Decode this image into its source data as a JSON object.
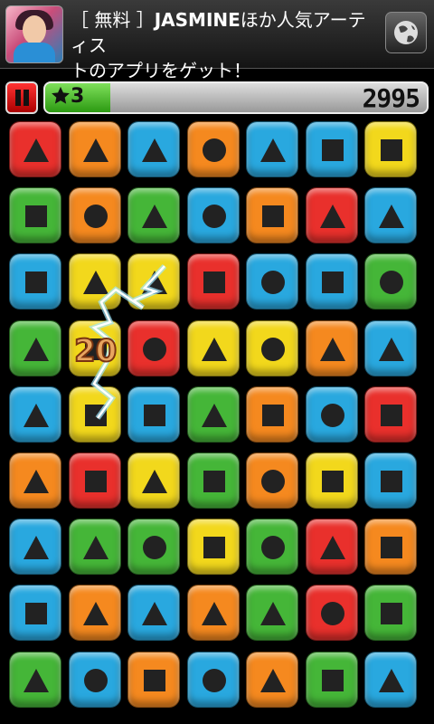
{
  "ad": {
    "line1_prefix": "［ 無料 ］",
    "line1_brand": "JASMINE",
    "line1_suffix": "ほか人気アーティス",
    "line2": "トのアプリをゲット！"
  },
  "hud": {
    "level": "3",
    "score": "2995",
    "progress_fraction": 0.17
  },
  "popup_points": "20",
  "colors": {
    "red": "#e9302c",
    "orange": "#f5891f",
    "blue": "#29a8df",
    "green": "#45b638",
    "yellow": "#f2d81c"
  },
  "board": [
    [
      [
        "red",
        "triangle"
      ],
      [
        "orange",
        "triangle"
      ],
      [
        "blue",
        "triangle"
      ],
      [
        "orange",
        "circle"
      ],
      [
        "blue",
        "triangle"
      ],
      [
        "blue",
        "square"
      ],
      [
        "yellow",
        "square"
      ]
    ],
    [
      [
        "green",
        "square"
      ],
      [
        "orange",
        "circle"
      ],
      [
        "green",
        "triangle"
      ],
      [
        "blue",
        "circle"
      ],
      [
        "orange",
        "square"
      ],
      [
        "red",
        "triangle"
      ],
      [
        "blue",
        "triangle"
      ]
    ],
    [
      [
        "blue",
        "square"
      ],
      [
        "yellow",
        "triangle"
      ],
      [
        "yellow",
        "triangle"
      ],
      [
        "red",
        "square"
      ],
      [
        "blue",
        "circle"
      ],
      [
        "blue",
        "square"
      ],
      [
        "green",
        "circle"
      ]
    ],
    [
      [
        "green",
        "triangle"
      ],
      [
        "yellow",
        "square"
      ],
      [
        "red",
        "circle"
      ],
      [
        "yellow",
        "triangle"
      ],
      [
        "yellow",
        "circle"
      ],
      [
        "orange",
        "triangle"
      ],
      [
        "blue",
        "triangle"
      ]
    ],
    [
      [
        "blue",
        "triangle"
      ],
      [
        "yellow",
        "square"
      ],
      [
        "blue",
        "square"
      ],
      [
        "green",
        "triangle"
      ],
      [
        "orange",
        "square"
      ],
      [
        "blue",
        "circle"
      ],
      [
        "red",
        "square"
      ]
    ],
    [
      [
        "orange",
        "triangle"
      ],
      [
        "red",
        "square"
      ],
      [
        "yellow",
        "triangle"
      ],
      [
        "green",
        "square"
      ],
      [
        "orange",
        "circle"
      ],
      [
        "yellow",
        "square"
      ],
      [
        "blue",
        "square"
      ]
    ],
    [
      [
        "blue",
        "triangle"
      ],
      [
        "green",
        "triangle"
      ],
      [
        "green",
        "circle"
      ],
      [
        "yellow",
        "square"
      ],
      [
        "green",
        "circle"
      ],
      [
        "red",
        "triangle"
      ],
      [
        "orange",
        "square"
      ]
    ],
    [
      [
        "blue",
        "square"
      ],
      [
        "orange",
        "triangle"
      ],
      [
        "blue",
        "triangle"
      ],
      [
        "orange",
        "triangle"
      ],
      [
        "green",
        "triangle"
      ],
      [
        "red",
        "circle"
      ],
      [
        "green",
        "square"
      ]
    ],
    [
      [
        "green",
        "triangle"
      ],
      [
        "blue",
        "circle"
      ],
      [
        "orange",
        "square"
      ],
      [
        "blue",
        "circle"
      ],
      [
        "orange",
        "triangle"
      ],
      [
        "green",
        "square"
      ],
      [
        "blue",
        "triangle"
      ]
    ]
  ]
}
